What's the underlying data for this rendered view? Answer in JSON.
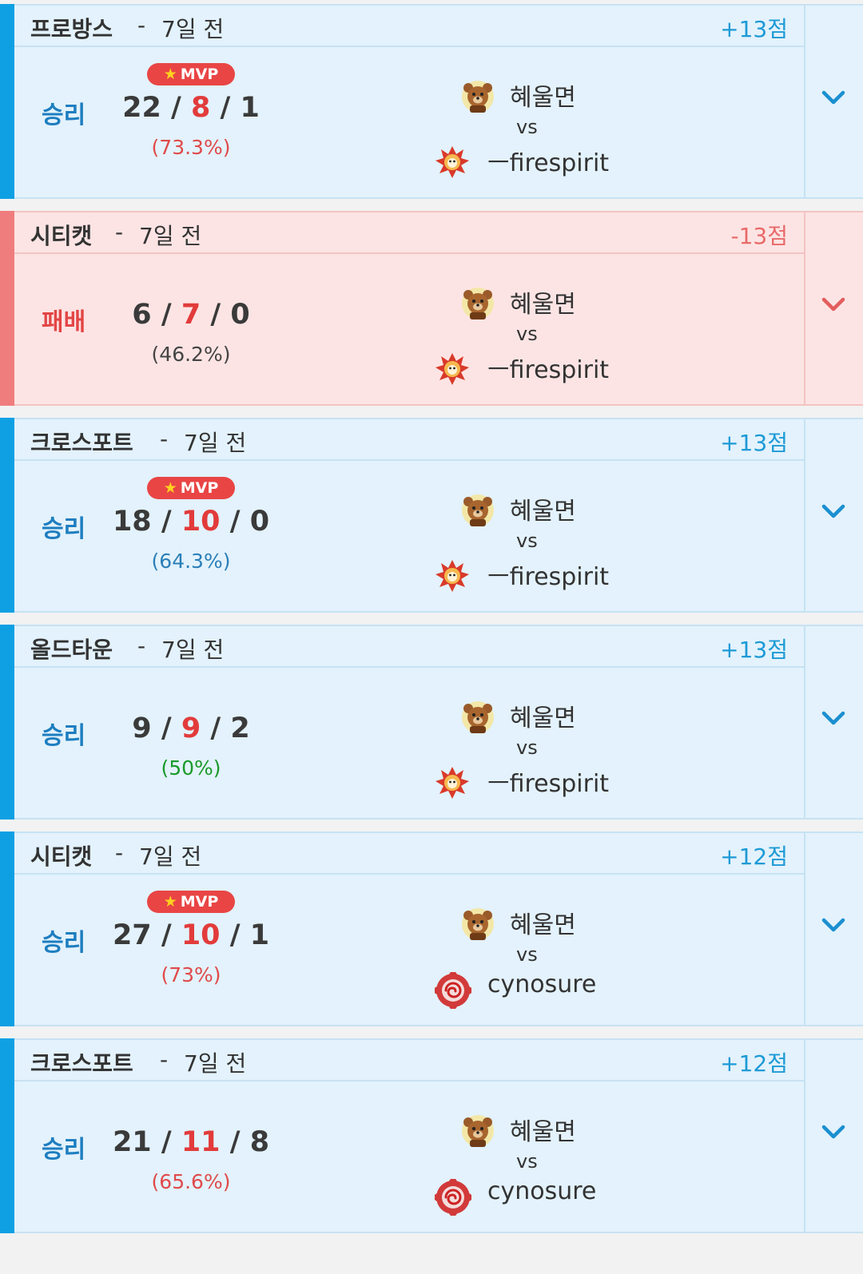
{
  "matches": [
    {
      "outcome": "win",
      "map": "프로방스",
      "separator": "-",
      "when": "7일 전",
      "points": "+13점",
      "result_label": "승리",
      "mvp": true,
      "mvp_label": "MVP",
      "kills": "22",
      "deaths": "8",
      "assists": "1",
      "ratio": "(73.3%)",
      "ratio_color": "#e04a4a",
      "player1": "혜울면",
      "player1_avatar": "bear-avatar-icon",
      "vs": "vs",
      "player2": "ㅡfirespirit",
      "player2_avatar": "fire-spirit-avatar-icon"
    },
    {
      "outcome": "loss",
      "map": "시티캣",
      "separator": "-",
      "when": "7일 전",
      "points": "-13점",
      "result_label": "패배",
      "mvp": false,
      "mvp_label": "",
      "kills": "6",
      "deaths": "7",
      "assists": "0",
      "ratio": "(46.2%)",
      "ratio_color": "#444444",
      "player1": "혜울면",
      "player1_avatar": "bear-avatar-icon",
      "vs": "vs",
      "player2": "ㅡfirespirit",
      "player2_avatar": "fire-spirit-avatar-icon"
    },
    {
      "outcome": "win",
      "map": "크로스포트",
      "separator": "-",
      "when": "7일 전",
      "points": "+13점",
      "result_label": "승리",
      "mvp": true,
      "mvp_label": "MVP",
      "kills": "18",
      "deaths": "10",
      "assists": "0",
      "ratio": "(64.3%)",
      "ratio_color": "#2b7fb8",
      "player1": "혜울면",
      "player1_avatar": "bear-avatar-icon",
      "vs": "vs",
      "player2": "ㅡfirespirit",
      "player2_avatar": "fire-spirit-avatar-icon"
    },
    {
      "outcome": "win",
      "map": "올드타운",
      "separator": "-",
      "when": "7일 전",
      "points": "+13점",
      "result_label": "승리",
      "mvp": false,
      "mvp_label": "",
      "kills": "9",
      "deaths": "9",
      "assists": "2",
      "ratio": "(50%)",
      "ratio_color": "#1a9a2a",
      "player1": "혜울면",
      "player1_avatar": "bear-avatar-icon",
      "vs": "vs",
      "player2": "ㅡfirespirit",
      "player2_avatar": "fire-spirit-avatar-icon"
    },
    {
      "outcome": "win",
      "map": "시티캣",
      "separator": "-",
      "when": "7일 전",
      "points": "+12점",
      "result_label": "승리",
      "mvp": true,
      "mvp_label": "MVP",
      "kills": "27",
      "deaths": "10",
      "assists": "1",
      "ratio": "(73%)",
      "ratio_color": "#e04a4a",
      "player1": "혜울면",
      "player1_avatar": "bear-avatar-icon",
      "vs": "vs",
      "player2": "cynosure",
      "player2_avatar": "red-swirl-avatar-icon"
    },
    {
      "outcome": "win",
      "map": "크로스포트",
      "separator": "-",
      "when": "7일 전",
      "points": "+12점",
      "result_label": "승리",
      "mvp": false,
      "mvp_label": "",
      "kills": "21",
      "deaths": "11",
      "assists": "8",
      "ratio": "(65.6%)",
      "ratio_color": "#e04a4a",
      "player1": "혜울면",
      "player1_avatar": "bear-avatar-icon",
      "vs": "vs",
      "player2": "cynosure",
      "player2_avatar": "red-swirl-avatar-icon"
    }
  ],
  "colors": {
    "win_accent": "#0fa0e4",
    "loss_accent": "#f07d7d",
    "win_bg": "#e3f2fc",
    "loss_bg": "#fde4e4",
    "mvp_badge": "#e94545"
  }
}
